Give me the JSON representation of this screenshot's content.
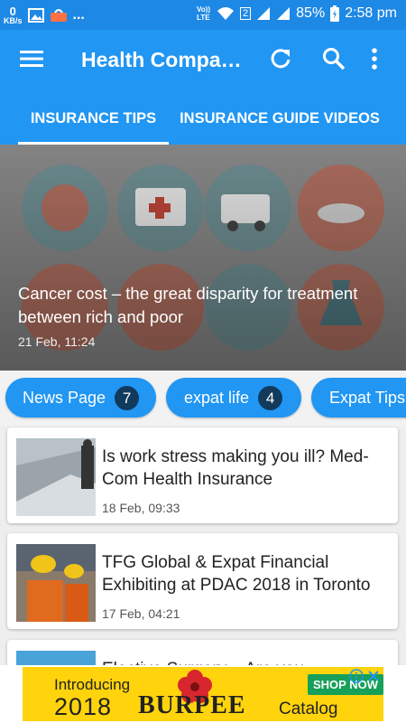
{
  "status_bar": {
    "net_speed_value": "0",
    "net_speed_unit": "KB/s",
    "more": "...",
    "lte_label": "Vo)) LTE",
    "sim_badge": "2",
    "battery": "85%",
    "time": "2:58 pm"
  },
  "app_bar": {
    "title": "Health Companion",
    "tabs": [
      {
        "label": "INSURANCE TIPS",
        "active": true
      },
      {
        "label": "INSURANCE GUIDE VIDEOS",
        "active": false
      }
    ]
  },
  "featured": {
    "title": "Cancer cost – the great disparity for treatment between rich and poor",
    "time": "21 Feb, 11:24"
  },
  "chips": [
    {
      "label": "News Page",
      "count": "7"
    },
    {
      "label": "expat life",
      "count": "4"
    },
    {
      "label": "Expat Tips",
      "count": ""
    }
  ],
  "articles": [
    {
      "title": "Is work stress making you ill? Med-Com Health Insurance",
      "time": "18 Feb, 09:33"
    },
    {
      "title": "TFG Global & Expat Financial Exhibiting at PDAC 2018 in Toronto",
      "time": "17 Feb, 04:21"
    },
    {
      "title": "Elective Surgery – Are you",
      "time": ""
    }
  ],
  "ad": {
    "intro": "Introducing",
    "year": "2018",
    "brand": "BURPEE",
    "catalog": "Catalog",
    "shop_button": "SHOP NOW"
  },
  "colors": {
    "primary": "#2196f3",
    "status_bar": "#1e88e5",
    "chip_count_bg": "#123a5c",
    "ad_yellow": "#ffd40c"
  },
  "icons": [
    "menu-icon",
    "refresh-icon",
    "search-icon",
    "more-vert-icon",
    "wifi-icon",
    "signal-icon",
    "battery-icon"
  ]
}
